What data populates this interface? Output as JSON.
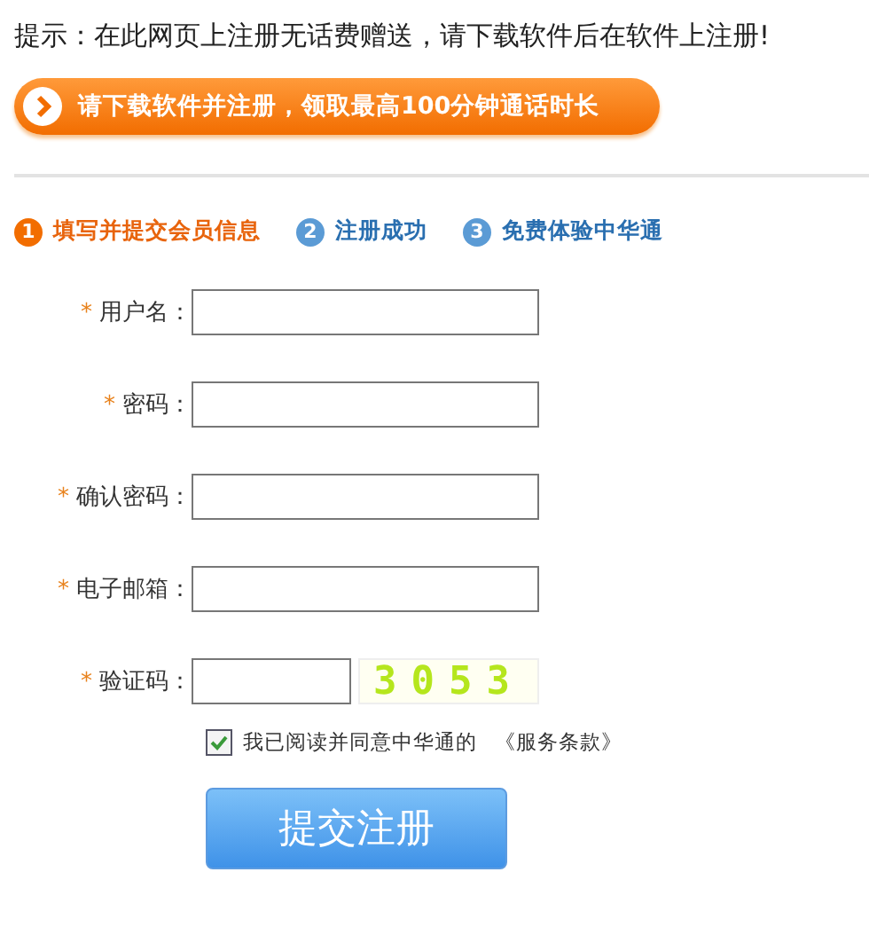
{
  "notice": "提示：在此网页上注册无话费赠送，请下载软件后在软件上注册!",
  "banner": {
    "text": "请下载软件并注册，领取最高100分钟通话时长"
  },
  "steps": [
    {
      "number": "1",
      "label": "填写并提交会员信息",
      "selected": true
    },
    {
      "number": "2",
      "label": "注册成功",
      "selected": false
    },
    {
      "number": "3",
      "label": "免费体验中华通",
      "selected": false
    }
  ],
  "fields": [
    {
      "kind": "text",
      "required": "*",
      "label": "用户名："
    },
    {
      "kind": "text",
      "required": "*",
      "label": "密码："
    },
    {
      "kind": "text",
      "required": "*",
      "label": "确认密码："
    },
    {
      "kind": "text",
      "required": "*",
      "label": "电子邮箱："
    },
    {
      "kind": "captcha",
      "required": "*",
      "label": "验证码：",
      "captcha": "3053"
    }
  ],
  "agreement": {
    "checked": true,
    "text": "我已阅读并同意中华通的",
    "link": "《服务条款》"
  },
  "submit": "提交注册"
}
